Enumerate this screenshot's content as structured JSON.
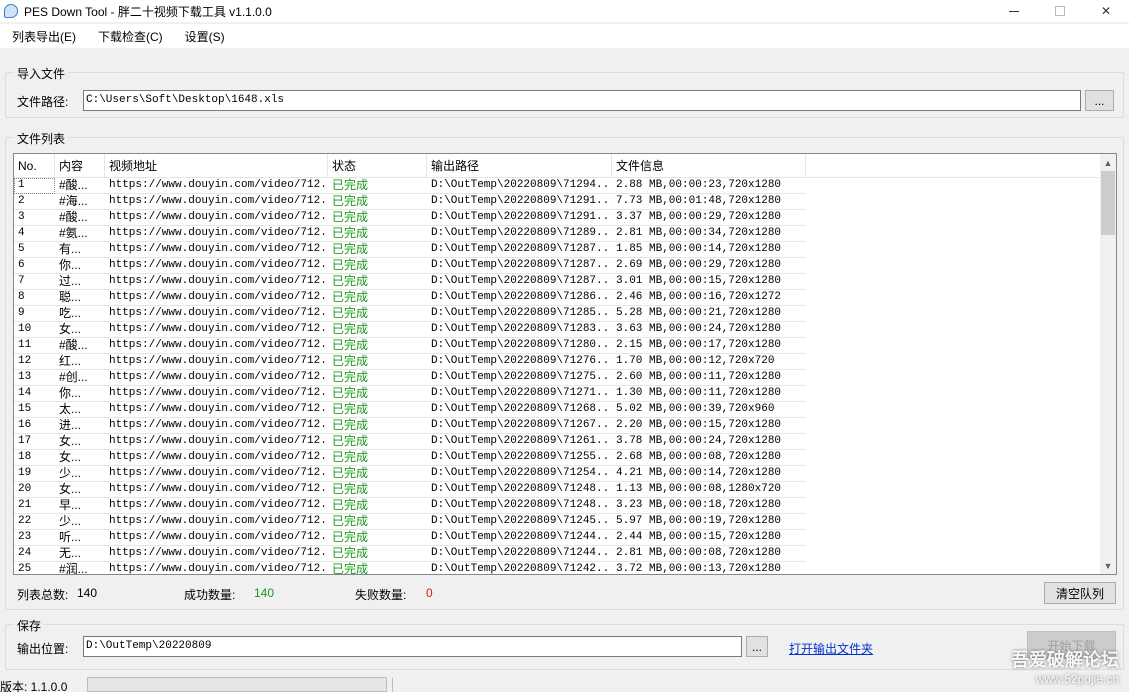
{
  "window": {
    "title": "PES Down Tool - 胖二十视频下载工具 v1.1.0.0",
    "min": "",
    "max": "",
    "close": "✕"
  },
  "menu": [
    {
      "label": "列表导出(E)"
    },
    {
      "label": "下载检查(C)"
    },
    {
      "label": "设置(S)"
    }
  ],
  "import_group": {
    "title": "导入文件",
    "path_label": "文件路径:",
    "path_value": "C:\\Users\\Soft\\Desktop\\1648.xls",
    "browse_label": "..."
  },
  "file_list": {
    "title": "文件列表",
    "columns": [
      "No.",
      "内容",
      "视频地址",
      "状态",
      "输出路径",
      "文件信息"
    ],
    "rows": [
      {
        "no": "1",
        "content": "#酸...",
        "url": "https://www.douyin.com/video/712...",
        "status": "已完成",
        "out": "D:\\OutTemp\\20220809\\71294...",
        "info": "2.88 MB,00:00:23,720x1280"
      },
      {
        "no": "2",
        "content": "#海...",
        "url": "https://www.douyin.com/video/712...",
        "status": "已完成",
        "out": "D:\\OutTemp\\20220809\\71291...",
        "info": "7.73 MB,00:01:48,720x1280"
      },
      {
        "no": "3",
        "content": "#酸...",
        "url": "https://www.douyin.com/video/712...",
        "status": "已完成",
        "out": "D:\\OutTemp\\20220809\\71291...",
        "info": "3.37 MB,00:00:29,720x1280"
      },
      {
        "no": "4",
        "content": "#氨...",
        "url": "https://www.douyin.com/video/712...",
        "status": "已完成",
        "out": "D:\\OutTemp\\20220809\\71289...",
        "info": "2.81 MB,00:00:34,720x1280"
      },
      {
        "no": "5",
        "content": "有...",
        "url": "https://www.douyin.com/video/712...",
        "status": "已完成",
        "out": "D:\\OutTemp\\20220809\\71287...",
        "info": "1.85 MB,00:00:14,720x1280"
      },
      {
        "no": "6",
        "content": "你...",
        "url": "https://www.douyin.com/video/712...",
        "status": "已完成",
        "out": "D:\\OutTemp\\20220809\\71287...",
        "info": "2.69 MB,00:00:29,720x1280"
      },
      {
        "no": "7",
        "content": "过...",
        "url": "https://www.douyin.com/video/712...",
        "status": "已完成",
        "out": "D:\\OutTemp\\20220809\\71287...",
        "info": "3.01 MB,00:00:15,720x1280"
      },
      {
        "no": "8",
        "content": "聪...",
        "url": "https://www.douyin.com/video/712...",
        "status": "已完成",
        "out": "D:\\OutTemp\\20220809\\71286...",
        "info": "2.46 MB,00:00:16,720x1272"
      },
      {
        "no": "9",
        "content": "吃...",
        "url": "https://www.douyin.com/video/712...",
        "status": "已完成",
        "out": "D:\\OutTemp\\20220809\\71285...",
        "info": "5.28 MB,00:00:21,720x1280"
      },
      {
        "no": "10",
        "content": "女...",
        "url": "https://www.douyin.com/video/712...",
        "status": "已完成",
        "out": "D:\\OutTemp\\20220809\\71283...",
        "info": "3.63 MB,00:00:24,720x1280"
      },
      {
        "no": "11",
        "content": "#酸...",
        "url": "https://www.douyin.com/video/712...",
        "status": "已完成",
        "out": "D:\\OutTemp\\20220809\\71280...",
        "info": "2.15 MB,00:00:17,720x1280"
      },
      {
        "no": "12",
        "content": "红...",
        "url": "https://www.douyin.com/video/712...",
        "status": "已完成",
        "out": "D:\\OutTemp\\20220809\\71276...",
        "info": "1.70 MB,00:00:12,720x720"
      },
      {
        "no": "13",
        "content": "#创...",
        "url": "https://www.douyin.com/video/712...",
        "status": "已完成",
        "out": "D:\\OutTemp\\20220809\\71275...",
        "info": "2.60 MB,00:00:11,720x1280"
      },
      {
        "no": "14",
        "content": "你...",
        "url": "https://www.douyin.com/video/712...",
        "status": "已完成",
        "out": "D:\\OutTemp\\20220809\\71271...",
        "info": "1.30 MB,00:00:11,720x1280"
      },
      {
        "no": "15",
        "content": "太...",
        "url": "https://www.douyin.com/video/712...",
        "status": "已完成",
        "out": "D:\\OutTemp\\20220809\\71268...",
        "info": "5.02 MB,00:00:39,720x960"
      },
      {
        "no": "16",
        "content": "进...",
        "url": "https://www.douyin.com/video/712...",
        "status": "已完成",
        "out": "D:\\OutTemp\\20220809\\71267...",
        "info": "2.20 MB,00:00:15,720x1280"
      },
      {
        "no": "17",
        "content": "女...",
        "url": "https://www.douyin.com/video/712...",
        "status": "已完成",
        "out": "D:\\OutTemp\\20220809\\71261...",
        "info": "3.78 MB,00:00:24,720x1280"
      },
      {
        "no": "18",
        "content": "女...",
        "url": "https://www.douyin.com/video/712...",
        "status": "已完成",
        "out": "D:\\OutTemp\\20220809\\71255...",
        "info": "2.68 MB,00:00:08,720x1280"
      },
      {
        "no": "19",
        "content": "少...",
        "url": "https://www.douyin.com/video/712...",
        "status": "已完成",
        "out": "D:\\OutTemp\\20220809\\71254...",
        "info": "4.21 MB,00:00:14,720x1280"
      },
      {
        "no": "20",
        "content": "女...",
        "url": "https://www.douyin.com/video/712...",
        "status": "已完成",
        "out": "D:\\OutTemp\\20220809\\71248...",
        "info": "1.13 MB,00:00:08,1280x720"
      },
      {
        "no": "21",
        "content": "早...",
        "url": "https://www.douyin.com/video/712...",
        "status": "已完成",
        "out": "D:\\OutTemp\\20220809\\71248...",
        "info": "3.23 MB,00:00:18,720x1280"
      },
      {
        "no": "22",
        "content": "少...",
        "url": "https://www.douyin.com/video/712...",
        "status": "已完成",
        "out": "D:\\OutTemp\\20220809\\71245...",
        "info": "5.97 MB,00:00:19,720x1280"
      },
      {
        "no": "23",
        "content": "听...",
        "url": "https://www.douyin.com/video/712...",
        "status": "已完成",
        "out": "D:\\OutTemp\\20220809\\71244...",
        "info": "2.44 MB,00:00:15,720x1280"
      },
      {
        "no": "24",
        "content": "无...",
        "url": "https://www.douyin.com/video/712...",
        "status": "已完成",
        "out": "D:\\OutTemp\\20220809\\71244...",
        "info": "2.81 MB,00:00:08,720x1280"
      },
      {
        "no": "25",
        "content": "#润...",
        "url": "https://www.douyin.com/video/712...",
        "status": "已完成",
        "out": "D:\\OutTemp\\20220809\\71242...",
        "info": "3.72 MB,00:00:13,720x1280"
      }
    ],
    "total_label": "列表总数:",
    "total_value": "140",
    "success_label": "成功数量:",
    "success_value": "140",
    "fail_label": "失败数量:",
    "fail_value": "0",
    "clear_label": "清空队列"
  },
  "save_group": {
    "title": "保存",
    "out_label": "输出位置:",
    "out_value": "D:\\OutTemp\\20220809",
    "browse_label": "...",
    "open_folder_label": "打开输出文件夹",
    "start_label": "开始下载"
  },
  "status": {
    "version": "版本: 1.1.0.0"
  },
  "watermark": {
    "line1": "吾爱破解论坛",
    "line2": "www.52pojie.cn"
  },
  "colors": {
    "status_ok": "#1a9a1a",
    "fail": "#d02020",
    "link": "#0033cc"
  }
}
